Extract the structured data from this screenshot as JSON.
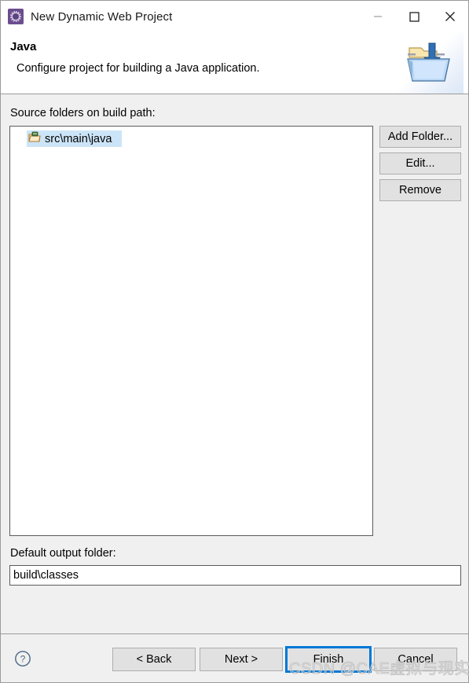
{
  "window": {
    "title": "New Dynamic Web Project",
    "icon": "eclipse-wizard-icon",
    "controls": {
      "minimize": "minimize-icon",
      "maximize": "maximize-icon",
      "close": "close-icon"
    }
  },
  "header": {
    "title": "Java",
    "description": "Configure project for building a Java application.",
    "banner_icon": "folder-import-icon"
  },
  "main": {
    "source_folders_label": "Source folders on build path:",
    "list_items": [
      {
        "label": "src\\main\\java",
        "icon": "java-package-folder-icon",
        "selected": true
      }
    ],
    "side_buttons": [
      {
        "label": "Add Folder...",
        "name": "add-folder-button",
        "enabled": true
      },
      {
        "label": "Edit...",
        "name": "edit-button",
        "enabled": true
      },
      {
        "label": "Remove",
        "name": "remove-button",
        "enabled": true
      }
    ],
    "output_folder_label": "Default output folder:",
    "output_folder_value": "build\\classes",
    "output_folder_placeholder": ""
  },
  "footer": {
    "help_icon": "help-question-icon",
    "buttons": [
      {
        "label": "< Back",
        "name": "back-button",
        "focused": false
      },
      {
        "label": "Next >",
        "name": "next-button",
        "focused": false
      },
      {
        "label": "Finish",
        "name": "finish-button",
        "focused": true
      },
      {
        "label": "Cancel",
        "name": "cancel-button",
        "focused": false
      }
    ]
  },
  "watermark": {
    "text": "CSDN @CAE虚拟与现实"
  },
  "colors": {
    "accent": "#0078d7",
    "selection": "#cce4f7",
    "dialog_bg": "#f0f0f0",
    "button_bg": "#e1e1e1",
    "field_border": "#5b5b5b"
  }
}
